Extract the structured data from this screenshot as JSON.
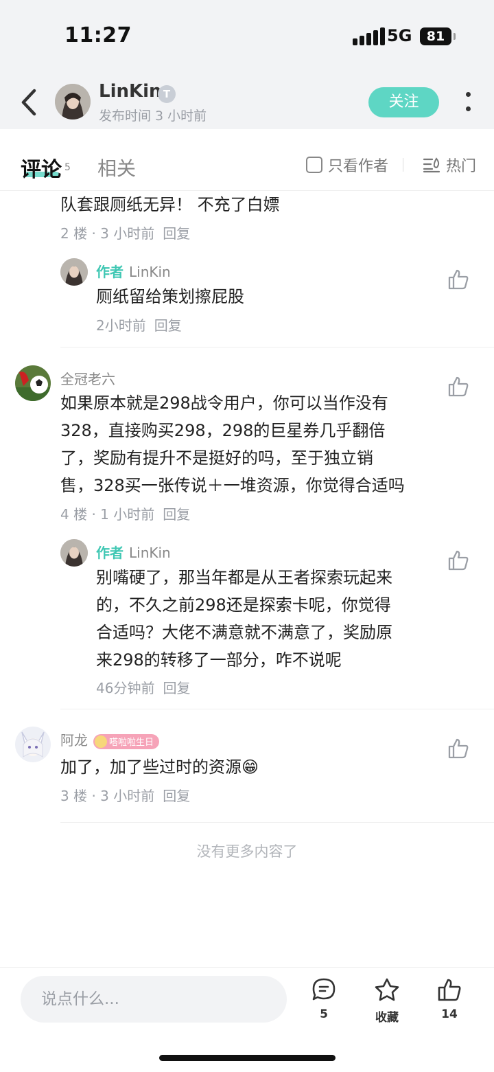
{
  "status_bar": {
    "time": "11:27",
    "network": "5G",
    "battery": "81"
  },
  "header": {
    "author_name": "LinKin",
    "badge": "T",
    "post_time": "发布时间 3 小时前",
    "follow_label": "关注"
  },
  "tabs": {
    "comments_label": "评论",
    "comments_count": "5",
    "related_label": "相关",
    "author_only_label": "只看作者",
    "sort_label": "热门"
  },
  "comments": [
    {
      "text": "队套跟厕纸无异！  不充了白嫖",
      "floor": "2 楼 · 3 小时前",
      "reply_label": "回复",
      "replies": [
        {
          "author_tag": "作者",
          "user": "LinKin",
          "text": "厕纸留给策划擦屁股",
          "time": "2小时前",
          "reply_label": "回复"
        }
      ]
    },
    {
      "user": "全冠老六",
      "lines": [
        "如果原本就是298战令用户，你可以当作没有",
        "328，直接购买298，298的巨星券几乎翻倍",
        "了，奖励有提升不是挺好的吗，至于独立销",
        "售，328买一张传说＋一堆资源，你觉得合适吗"
      ],
      "floor": "4 楼 · 1 小时前",
      "reply_label": "回复",
      "replies": [
        {
          "author_tag": "作者",
          "user": "LinKin",
          "lines": [
            "别嘴硬了，那当年都是从王者探索玩起来",
            "的，不久之前298还是探索卡呢，你觉得",
            "合适吗？大佬不满意就不满意了，奖励原",
            "来298的转移了一部分，咋不说呢"
          ],
          "time": "46分钟前",
          "reply_label": "回复"
        }
      ]
    },
    {
      "user": "阿龙",
      "badge": "嗒啦啦生日",
      "text": "加了，加了些过时的资源",
      "emoji": "😁",
      "floor": "3 楼 · 3 小时前",
      "reply_label": "回复"
    }
  ],
  "end_text": "没有更多内容了",
  "bottom_bar": {
    "input_placeholder": "说点什么...",
    "comment_count": "5",
    "favorite_label": "收藏",
    "like_count": "14"
  },
  "colors": {
    "accent": "#5ed6c4",
    "author_tag": "#3fc7b3",
    "badge_pink": "#f6a3b8"
  },
  "icons": [
    "back-arrow-icon",
    "more-dots-icon",
    "sort-hot-icon",
    "thumbs-up-icon",
    "comment-bubble-icon",
    "star-icon"
  ]
}
